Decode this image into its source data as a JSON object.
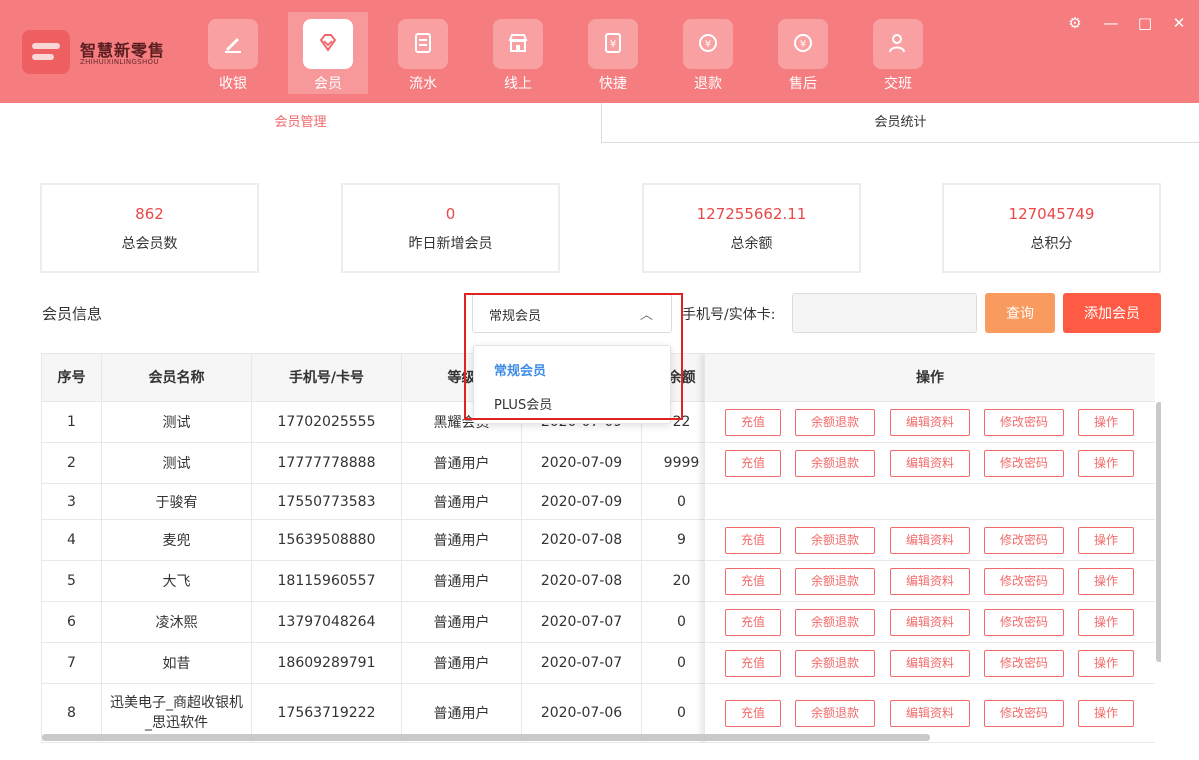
{
  "brand": {
    "name": "智慧新零售",
    "sub": "ZHIHUIXINLINGSHOU"
  },
  "nav": [
    {
      "label": "收银",
      "icon": "pen-icon"
    },
    {
      "label": "会员",
      "icon": "diamond-icon"
    },
    {
      "label": "流水",
      "icon": "document-icon"
    },
    {
      "label": "线上",
      "icon": "store-icon"
    },
    {
      "label": "快捷",
      "icon": "yen-receipt-icon"
    },
    {
      "label": "退款",
      "icon": "yen-refund-icon"
    },
    {
      "label": "售后",
      "icon": "yen-service-icon"
    },
    {
      "label": "交班",
      "icon": "user-key-icon"
    }
  ],
  "window": {
    "settings": "⚙",
    "minimize": "—",
    "maximize": "□",
    "close": "✕"
  },
  "tabs": {
    "manage": "会员管理",
    "stats": "会员统计"
  },
  "stats": [
    {
      "value": "862",
      "label": "总会员数"
    },
    {
      "value": "0",
      "label": "昨日新增会员"
    },
    {
      "value": "127255662.11",
      "label": "总余额"
    },
    {
      "value": "127045749",
      "label": "总积分"
    }
  ],
  "filter": {
    "section_label": "会员信息",
    "select_value": "常规会员",
    "options": [
      "常规会员",
      "PLUS会员"
    ],
    "phone_label": "手机号/实体卡:",
    "phone_placeholder": "",
    "query_button": "查询",
    "add_button": "添加会员"
  },
  "table": {
    "headers": [
      "序号",
      "会员名称",
      "手机号/卡号",
      "等级",
      "",
      "余额",
      "操作"
    ],
    "rows": [
      {
        "no": "1",
        "name": "测试",
        "phone": "17702025555",
        "level": "黑耀会员",
        "date": "2020-07-09",
        "balance": "22"
      },
      {
        "no": "2",
        "name": "测试",
        "phone": "17777778888",
        "level": "普通用户",
        "date": "2020-07-09",
        "balance": "9999"
      },
      {
        "no": "3",
        "name": "于骏宥",
        "phone": "17550773583",
        "level": "普通用户",
        "date": "2020-07-09",
        "balance": "0"
      },
      {
        "no": "4",
        "name": "麦兜",
        "phone": "15639508880",
        "level": "普通用户",
        "date": "2020-07-08",
        "balance": "9"
      },
      {
        "no": "5",
        "name": "大飞",
        "phone": "18115960557",
        "level": "普通用户",
        "date": "2020-07-08",
        "balance": "20"
      },
      {
        "no": "6",
        "name": "凌沐熙",
        "phone": "13797048264",
        "level": "普通用户",
        "date": "2020-07-07",
        "balance": "0"
      },
      {
        "no": "7",
        "name": "如昔",
        "phone": "18609289791",
        "level": "普通用户",
        "date": "2020-07-07",
        "balance": "0"
      },
      {
        "no": "8",
        "name": "迅美电子_商超收银机_思迅软件",
        "phone": "17563719222",
        "level": "普通用户",
        "date": "2020-07-06",
        "balance": "0"
      }
    ],
    "ops": [
      "充值",
      "余额退款",
      "编辑资料",
      "修改密码",
      "操作"
    ]
  }
}
